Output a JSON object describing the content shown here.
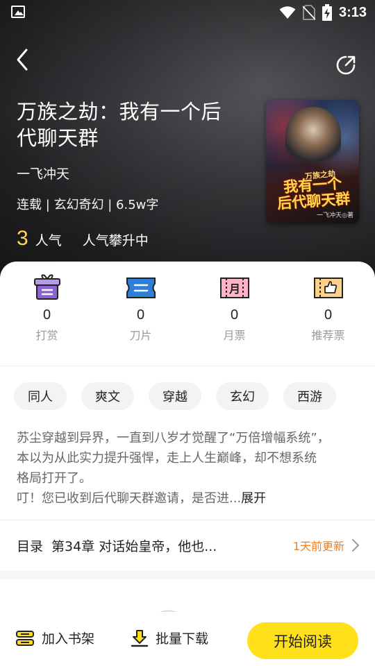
{
  "status_bar": {
    "time": "3:13",
    "icons": [
      "image-icon",
      "wifi-icon",
      "no-sim-icon",
      "battery-charging-icon"
    ]
  },
  "header": {
    "back_icon": "back-arrow-icon",
    "share_icon": "share-icon"
  },
  "book": {
    "title": "万族之劫：我有一个后代聊天群",
    "author": "一飞冲天",
    "meta": "连载 | 玄幻奇幻 | 6.5w字",
    "popularity_value": "3",
    "popularity_label": "人气",
    "popularity_status": "人气攀升中",
    "cover": {
      "series_text": "万族之劫",
      "title_line1": "我有一个",
      "title_line2": "后代聊天群",
      "author_text": "一飞冲天◎著"
    }
  },
  "stats": [
    {
      "value": "0",
      "label": "打赏",
      "icon": "gift-icon",
      "color": "#8a63d2"
    },
    {
      "value": "0",
      "label": "刀片",
      "icon": "ticket-icon",
      "color": "#2f7fd9"
    },
    {
      "value": "0",
      "label": "月票",
      "icon": "monthly-ticket-icon",
      "color": "#e0456e",
      "icon_text": "月"
    },
    {
      "value": "0",
      "label": "推荐票",
      "icon": "thumbs-up-ticket-icon",
      "color": "#e08a1e"
    }
  ],
  "tags": [
    "同人",
    "爽文",
    "穿越",
    "玄幻",
    "西游"
  ],
  "summary": {
    "lines": [
      "苏尘穿越到异界，一直到八岁才觉醒了“万倍增幅系统”，",
      "本以为从此实力提升强悍，走上人生巅峰，却不想系统",
      "格局打开了。",
      "叮！您已收到后代聊天群邀请，是否进..."
    ],
    "expand_label": "展开"
  },
  "catalog": {
    "label": "目录",
    "latest_chapter": "第34章 对话始皇帝，他也...",
    "updated": "1天前更新"
  },
  "bottom_bar": {
    "add_shelf_label": "加入书架",
    "batch_download_label": "批量下载",
    "start_reading_label": "开始阅读"
  },
  "colors": {
    "accent_yellow": "#ffe01a",
    "update_orange": "#f07c1c",
    "popularity_yellow": "#ffd84d"
  }
}
